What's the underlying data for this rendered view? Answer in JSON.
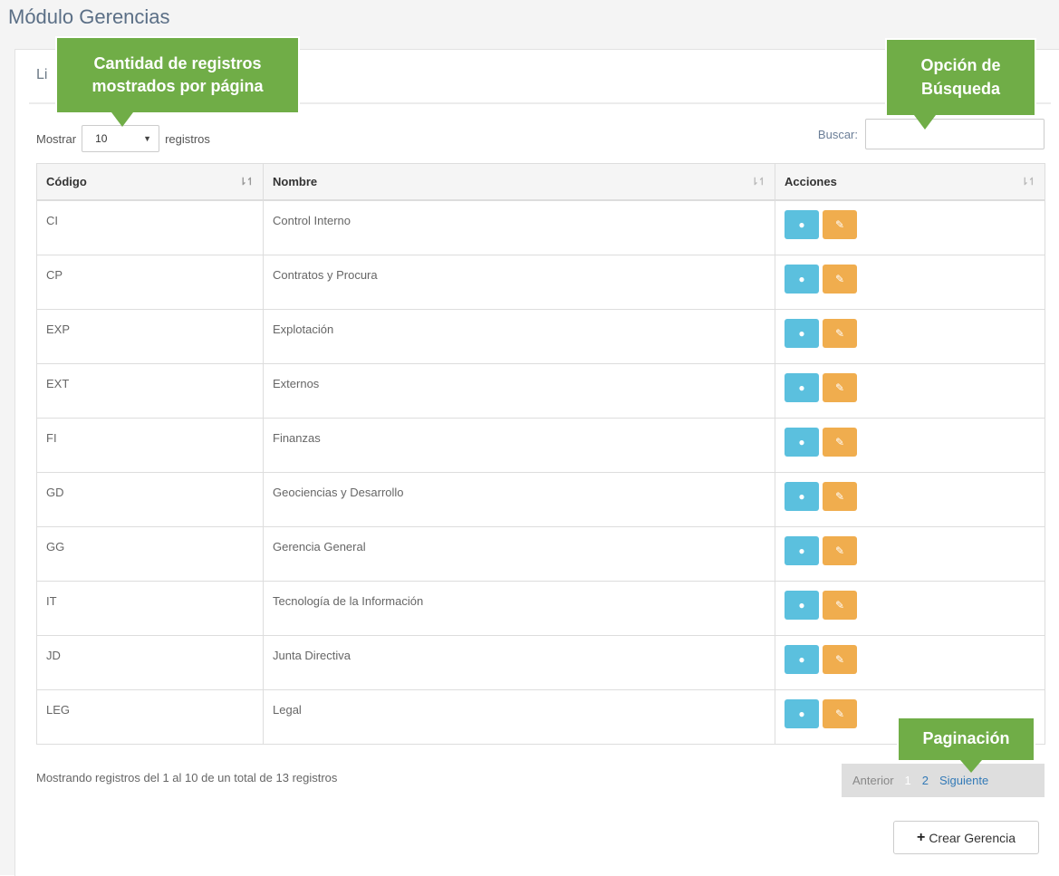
{
  "page": {
    "title": "Módulo Gerencias",
    "panel_heading": "Li"
  },
  "length": {
    "label_before": "Mostrar",
    "value": "10",
    "label_after": "registros"
  },
  "search": {
    "label": "Buscar:",
    "value": ""
  },
  "table": {
    "headers": [
      "Código",
      "Nombre",
      "Acciones"
    ],
    "rows": [
      {
        "code": "CI",
        "name": "Control Interno"
      },
      {
        "code": "CP",
        "name": "Contratos y Procura"
      },
      {
        "code": "EXP",
        "name": "Explotación"
      },
      {
        "code": "EXT",
        "name": "Externos"
      },
      {
        "code": "FI",
        "name": "Finanzas"
      },
      {
        "code": "GD",
        "name": "Geociencias y Desarrollo"
      },
      {
        "code": "GG",
        "name": "Gerencia General"
      },
      {
        "code": "IT",
        "name": "Tecnología de la Información"
      },
      {
        "code": "JD",
        "name": "Junta Directiva"
      },
      {
        "code": "LEG",
        "name": "Legal"
      }
    ],
    "row_actions": {
      "view_icon": "eye-icon",
      "edit_icon": "pencil-icon"
    }
  },
  "info": "Mostrando registros del 1 al 10 de un total de 13 registros",
  "pagination": {
    "prev": "Anterior",
    "pages": [
      "1",
      "2"
    ],
    "current": "1",
    "next": "Siguiente"
  },
  "create_button": {
    "icon": "plus-icon",
    "label": "Crear Gerencia"
  },
  "callouts": {
    "length": "Cantidad de registros mostrados por página",
    "search": "Opción de Búsqueda",
    "pagination": "Paginación"
  },
  "colors": {
    "view_button": "#5bc0de",
    "edit_button": "#f0ad4e",
    "callout": "#70ad47",
    "link": "#337ab7"
  }
}
